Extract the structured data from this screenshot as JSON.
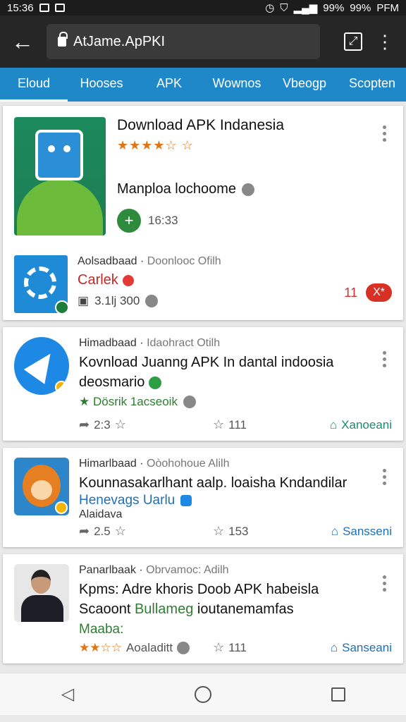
{
  "status": {
    "time": "15:36",
    "battery_a": "99%",
    "battery_b": "99%",
    "clock_right": "PFM"
  },
  "toolbar": {
    "url": "AtJame.ApPKI"
  },
  "tabs": [
    "Eloud",
    "Hooses",
    "APK",
    "Wownos",
    "Vbeogp",
    "Scopten"
  ],
  "featured": {
    "title": "Download APK Indanesia",
    "stars": "★★★★☆ ☆",
    "description": "Manploa lochoome",
    "time": "16:33"
  },
  "promo": {
    "subtitle_a": "Aolsadbaad ·",
    "subtitle_b": "Doonlooc Ofilh",
    "red_label": "Carlek",
    "count": "3.1lj 300",
    "red_num": "11",
    "pill": "X*"
  },
  "items": [
    {
      "subtitle_a": "Himadbaad ·",
      "subtitle_b": "Idaohract Otilh",
      "title": "Kovnload Juanng APK In dantal indoosia deosmario",
      "tag": "★ Dösrik 1acseoik",
      "like": "2:3",
      "fav": "111",
      "share": "Xanoeani"
    },
    {
      "subtitle_a": "Himarlbaad ·",
      "subtitle_b": "Oòohohoue Alilh",
      "title": "Kounnasakarlhant aalp. loaisha Kndandilar",
      "tag": "Henevags Uarlu",
      "tag2": "Alaidava",
      "like": "2.5",
      "fav": "153",
      "share": "Sansseni"
    },
    {
      "subtitle_a": "Panarlbaak ·",
      "subtitle_b": "Obrvamoc: Adilh",
      "title": "Kpms: Adre khoris Doob APK habeisla",
      "title2": "Scaoont",
      "title2_green": "Bullameg",
      "title2_rest": "ioutanemamfas",
      "tag": "Maaba:",
      "stars": "★★☆☆",
      "extra": "Aoaladitt",
      "fav": "111",
      "share": "Sanseani"
    }
  ],
  "colors": {
    "accent": "#1e88c9",
    "toolbar": "#262626",
    "status_bar": "#1c1c1c",
    "share_green": "#1e8a6c",
    "share_blue": "#1e6fb8",
    "red": "#d93025"
  }
}
